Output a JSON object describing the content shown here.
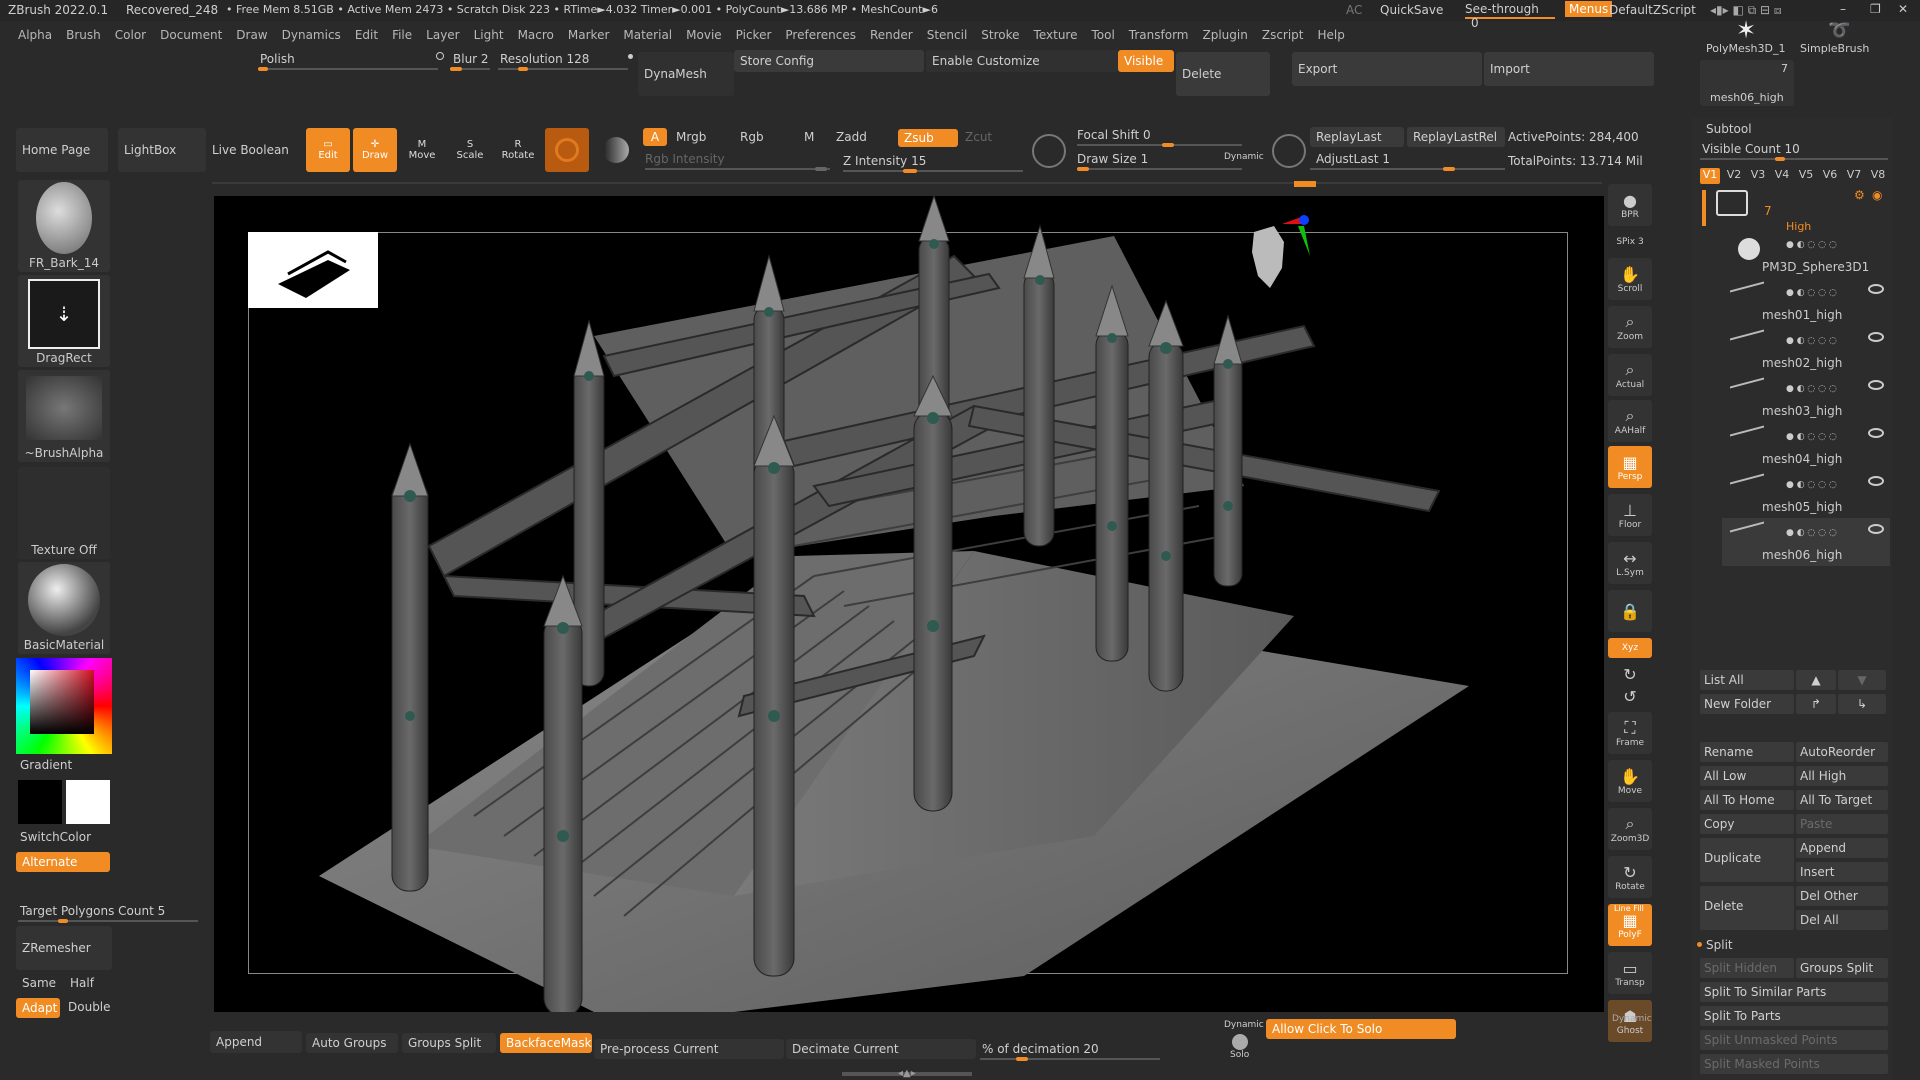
{
  "title_bar": {
    "app": "ZBrush 2022.0.1",
    "document": "Recovered_248",
    "stats": "• Free Mem 8.51GB • Active Mem 2473 • Scratch Disk 223 • RTime►4.032 Timer►0.001 • PolyCount►13.686 MP • MeshCount►6",
    "ac": "AC",
    "quicksave": "QuickSave",
    "see_through": "See-through",
    "see_through_value": "0",
    "menus": "Menus",
    "zscript": "DefaultZScript"
  },
  "menus": [
    "Alpha",
    "Brush",
    "Color",
    "Document",
    "Draw",
    "Dynamics",
    "Edit",
    "File",
    "Layer",
    "Light",
    "Macro",
    "Marker",
    "Material",
    "Movie",
    "Picker",
    "Preferences",
    "Render",
    "Stencil",
    "Stroke",
    "Texture",
    "Tool",
    "Transform",
    "Zplugin",
    "Zscript",
    "Help"
  ],
  "top_shelf": {
    "polish": "Polish",
    "blur": "Blur 2",
    "resolution": "Resolution 128",
    "dynamesh": "DynaMesh",
    "store_config": "Store Config",
    "enable_customize": "Enable Customize",
    "visible": "Visible",
    "delete": "Delete",
    "export": "Export",
    "import": "Import"
  },
  "tool_thumbs": {
    "tool1": "PolyMesh3D_1",
    "tool2": "SimpleBrush",
    "count": "7",
    "current": "mesh06_high"
  },
  "toolbar": {
    "home": "Home Page",
    "lightbox": "LightBox",
    "live_boolean": "Live Boolean",
    "edit": "Edit",
    "draw": "Draw",
    "move": "Move",
    "scale": "Scale",
    "rotate": "Rotate",
    "a": "A",
    "mrgb": "Mrgb",
    "rgb": "Rgb",
    "m": "M",
    "zadd": "Zadd",
    "zsub": "Zsub",
    "zcut": "Zcut",
    "rgb_intensity": "Rgb Intensity",
    "z_intensity": "Z Intensity 15",
    "focal_shift": "Focal Shift 0",
    "draw_size": "Draw Size 1",
    "dynamic": "Dynamic",
    "replay_last": "ReplayLast",
    "replay_last_rel": "ReplayLastRel",
    "adjust_last": "AdjustLast 1",
    "active_points": "ActivePoints: 284,400",
    "total_points": "TotalPoints: 13.714 Mil"
  },
  "left_panel": {
    "brush": "FR_Bark_14",
    "stroke": "DragRect",
    "alpha": "~BrushAlpha",
    "texture": "Texture Off",
    "material": "BasicMaterial",
    "gradient": "Gradient",
    "switch_color": "SwitchColor",
    "alternate": "Alternate",
    "target_polygons": "Target Polygons Count 5",
    "zremesher": "ZRemesher",
    "same": "Same",
    "half": "Half",
    "adapt": "Adapt",
    "double": "Double"
  },
  "right_shelf": [
    "BPR",
    "SPix 3",
    "Scroll",
    "Zoom",
    "Actual",
    "AAHalf",
    "Persp",
    "Floor",
    "L.Sym",
    "",
    "Xyz",
    "",
    "",
    "Frame",
    "Move",
    "Zoom3D",
    "Rotate",
    "PolyF",
    "Transp",
    "Ghost"
  ],
  "right_shelf_labels": {
    "dynamic": "Dynamic",
    "line_fill": "Line Fill"
  },
  "subtool": {
    "header": "Subtool",
    "visible_count": "Visible Count 10",
    "versions": [
      "V1",
      "V2",
      "V3",
      "V4",
      "V5",
      "V6",
      "V7",
      "V8"
    ],
    "folder_count": "7",
    "folder_label": "High",
    "items": [
      "PM3D_Sphere3D1",
      "mesh01_high",
      "mesh02_high",
      "mesh03_high",
      "mesh04_high",
      "mesh05_high",
      "mesh06_high"
    ],
    "list_all": "List All",
    "new_folder": "New Folder",
    "rename": "Rename",
    "auto_reorder": "AutoReorder",
    "all_low": "All Low",
    "all_high": "All High",
    "all_to_home": "All To Home",
    "all_to_target": "All To Target",
    "copy": "Copy",
    "paste": "Paste",
    "duplicate": "Duplicate",
    "append": "Append",
    "insert": "Insert",
    "delete": "Delete",
    "del_other": "Del Other",
    "del_all": "Del All",
    "split": "Split",
    "split_hidden": "Split Hidden",
    "groups_split": "Groups Split",
    "split_similar": "Split To Similar Parts",
    "split_parts": "Split To Parts",
    "split_unmasked": "Split Unmasked Points",
    "split_masked": "Split Masked Points"
  },
  "bottom_bar": {
    "append": "Append",
    "auto_groups": "Auto Groups",
    "groups_split": "Groups Split",
    "backface": "BackfaceMask",
    "preprocess": "Pre-process Current",
    "decimate": "Decimate Current",
    "decimation": "% of decimation 20",
    "dynamic": "Dynamic",
    "solo": "Solo",
    "allow_click": "Allow Click To Solo"
  },
  "colors": {
    "accent": "#f08c23",
    "panel": "#2a2a2a",
    "button": "#3a3a3a",
    "canvas": "#000000"
  }
}
